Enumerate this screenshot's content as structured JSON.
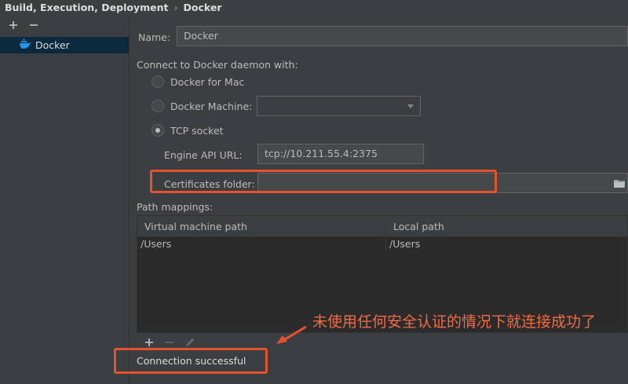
{
  "breadcrumb": {
    "parent": "Build, Execution, Deployment",
    "current": "Docker"
  },
  "tree": {
    "add": "+",
    "remove": "−",
    "items": [
      {
        "label": "Docker",
        "icon": "docker-whale-icon"
      }
    ]
  },
  "form": {
    "name_label": "Name:",
    "name_value": "Docker",
    "connect_label": "Connect to Docker daemon with:",
    "options": [
      {
        "label": "Docker for Mac",
        "selected": false
      },
      {
        "label": "Docker Machine:",
        "selected": false
      },
      {
        "label": "TCP socket",
        "selected": true
      }
    ],
    "engine_label": "Engine API URL:",
    "engine_value": "tcp://10.211.55.4:2375",
    "cert_label": "Certificates folder:",
    "cert_value": ""
  },
  "path_mappings": {
    "label": "Path mappings:",
    "columns": [
      "Virtual machine path",
      "Local path"
    ],
    "rows": [
      [
        "/Users",
        "/Users"
      ]
    ]
  },
  "status": "Connection successful",
  "annotation": "未使用任何安全认证的情况下就连接成功了",
  "colors": {
    "annotation": "#e8512e",
    "selection": "#0d293e",
    "docker_blue": "#2496ed"
  }
}
